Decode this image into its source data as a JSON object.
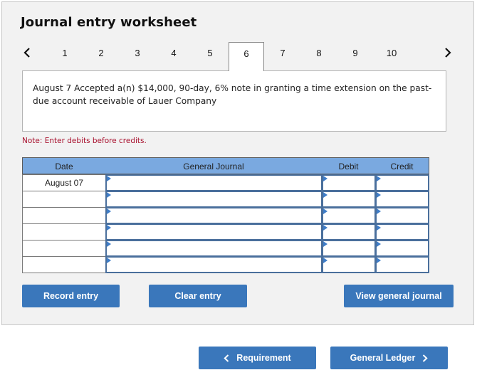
{
  "worksheet": {
    "title": "Journal entry worksheet",
    "tabs": [
      "1",
      "2",
      "3",
      "4",
      "5",
      "6",
      "7",
      "8",
      "9",
      "10"
    ],
    "active_tab": "6",
    "prev_icon": "chevron-left-icon",
    "next_icon": "chevron-right-icon"
  },
  "transaction": {
    "description": "August 7 Accepted a(n) $14,000, 90-day, 6% note in granting a time extension on the past-due account receivable of Lauer Company"
  },
  "note": "Note: Enter debits before credits.",
  "table": {
    "columns": [
      "Date",
      "General Journal",
      "Debit",
      "Credit"
    ],
    "rows": [
      {
        "date": "August 07",
        "account": "",
        "debit": "",
        "credit": ""
      },
      {
        "date": "",
        "account": "",
        "debit": "",
        "credit": ""
      },
      {
        "date": "",
        "account": "",
        "debit": "",
        "credit": ""
      },
      {
        "date": "",
        "account": "",
        "debit": "",
        "credit": ""
      },
      {
        "date": "",
        "account": "",
        "debit": "",
        "credit": ""
      },
      {
        "date": "",
        "account": "",
        "debit": "",
        "credit": ""
      }
    ]
  },
  "actions": {
    "record": "Record entry",
    "clear": "Clear entry",
    "view_journal": "View general journal"
  },
  "navigation": {
    "requirement": "Requirement",
    "general_ledger": "General Ledger"
  },
  "colors": {
    "header_blue": "#7aa9e0",
    "button_blue": "#3a77bb",
    "note_red": "#a8102d",
    "input_border": "#4a6f9c"
  }
}
